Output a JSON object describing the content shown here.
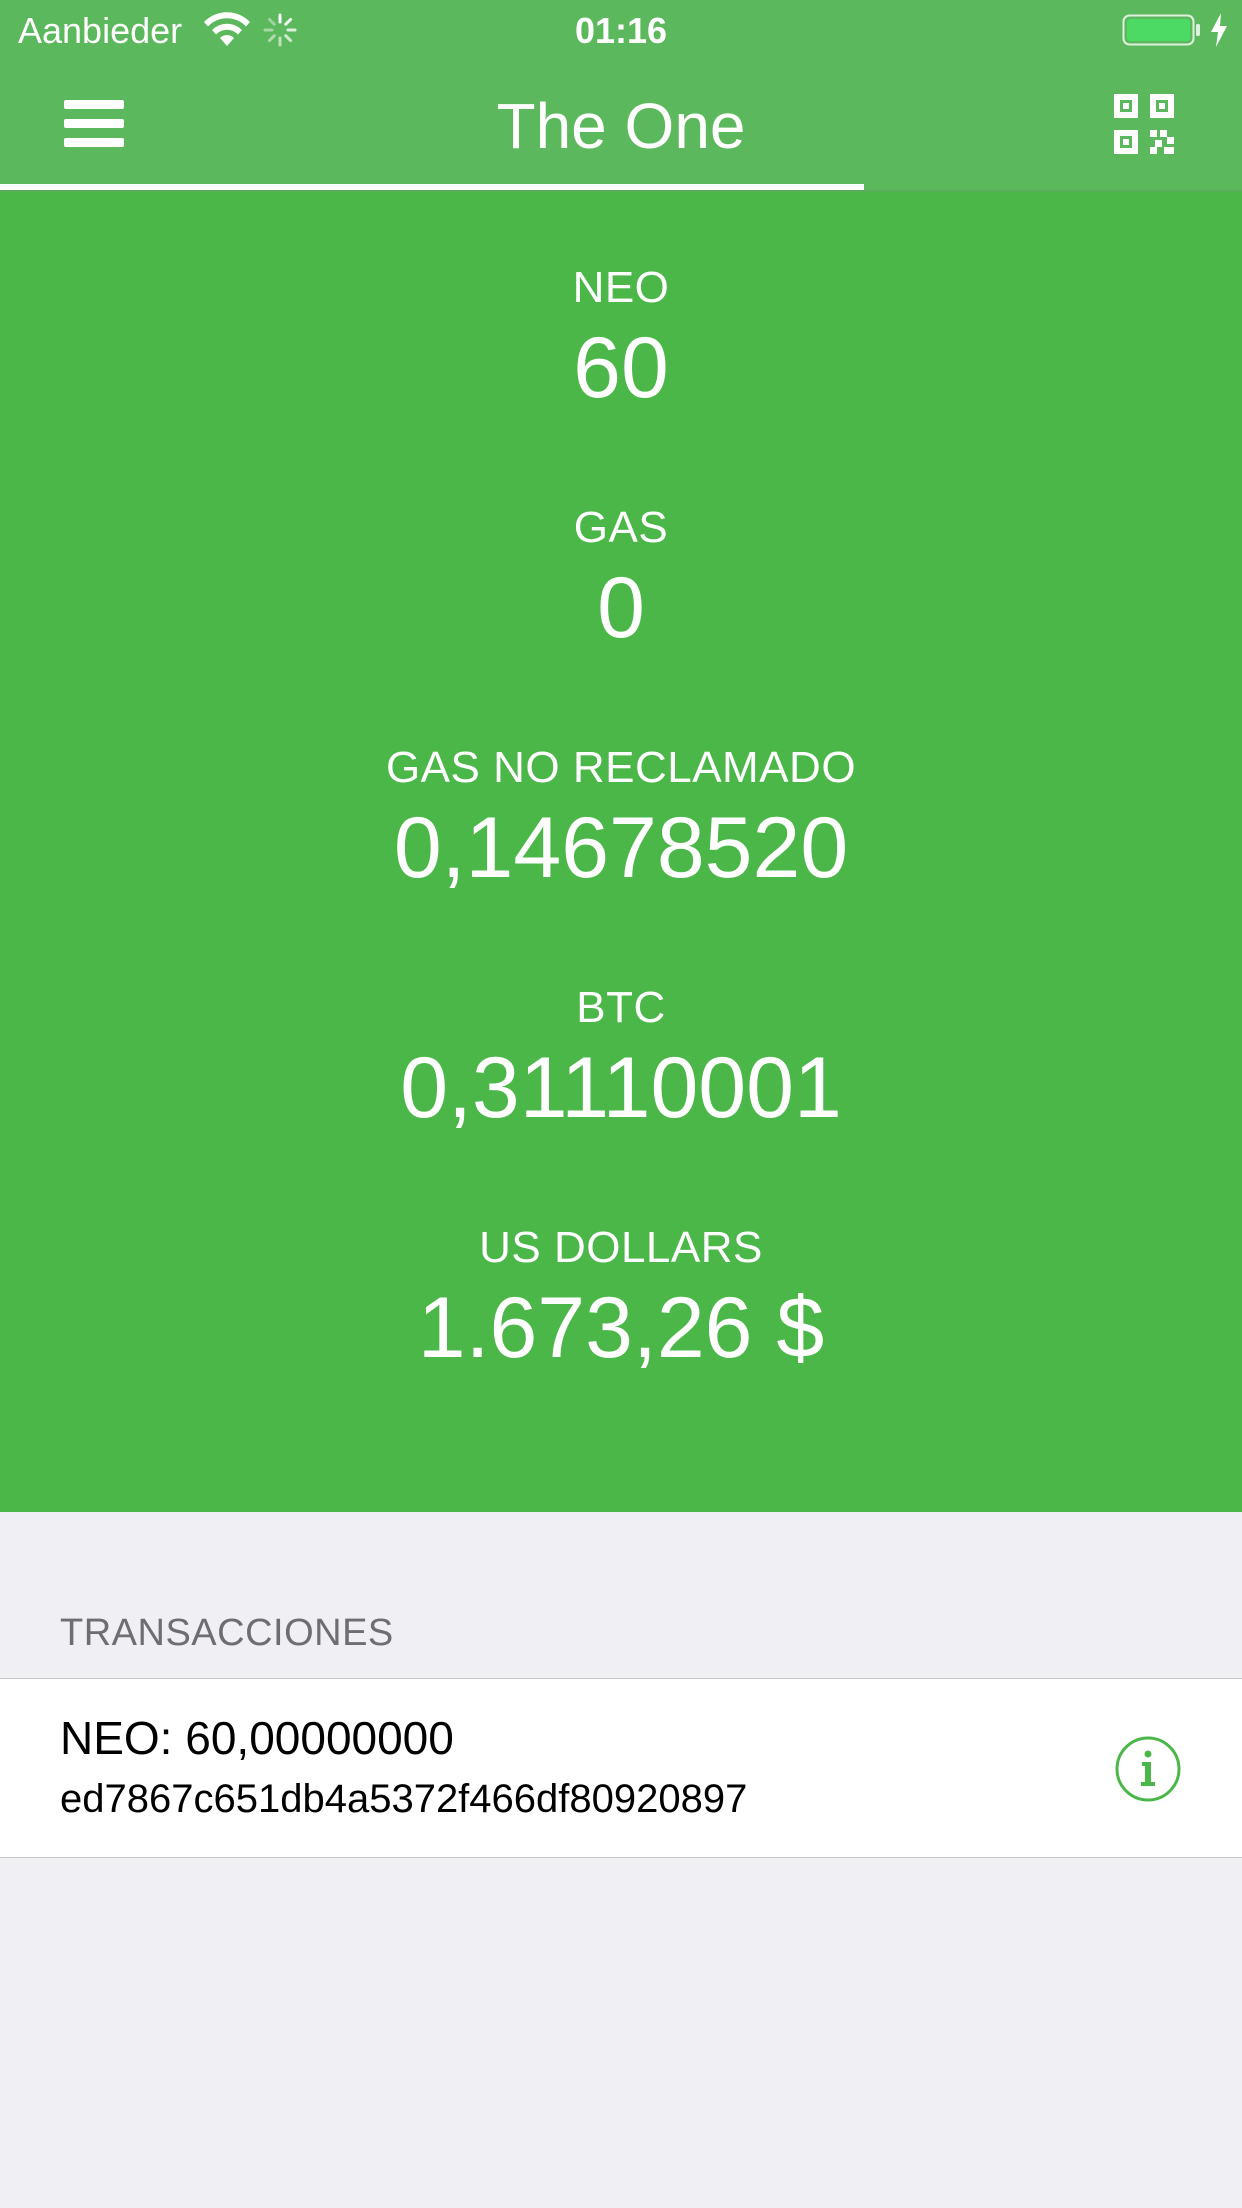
{
  "status_bar": {
    "carrier": "Aanbieder",
    "time": "01:16",
    "wifi_icon": "wifi-icon",
    "activity_icon": "activity-spinner-icon",
    "battery_icon": "battery-icon",
    "charging_icon": "charging-bolt-icon"
  },
  "nav": {
    "title": "The One",
    "menu_icon": "hamburger-menu-icon",
    "qr_icon": "qr-code-icon"
  },
  "balances": [
    {
      "label": "NEO",
      "value": "60"
    },
    {
      "label": "GAS",
      "value": "0"
    },
    {
      "label": "GAS NO RECLAMADO",
      "value": "0,14678520"
    },
    {
      "label": "BTC",
      "value": "0,31110001"
    },
    {
      "label": "US DOLLARS",
      "value": "1.673,26 $"
    }
  ],
  "transactions": {
    "header": "TRANSACCIONES",
    "items": [
      {
        "amount": "NEO: 60,00000000",
        "id": "ed7867c651db4a5372f466df80920897",
        "info_icon": "info-icon"
      }
    ]
  },
  "colors": {
    "nav_green": "#5cb85c",
    "panel_green": "#4bb749",
    "accent_green": "#4bb749",
    "background": "#efeff4",
    "battery_fill": "#4cd964"
  }
}
